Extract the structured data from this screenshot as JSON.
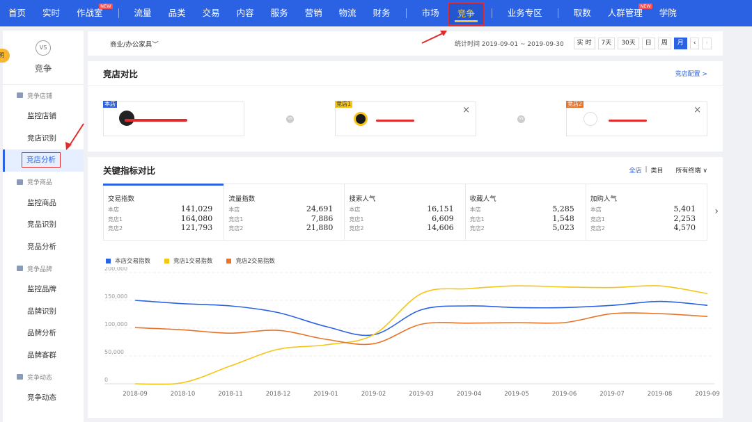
{
  "topnav": {
    "items": [
      {
        "label": "首页"
      },
      {
        "label": "实时"
      },
      {
        "label": "作战室",
        "badge": "NEW"
      },
      {
        "sep": true
      },
      {
        "label": "流量"
      },
      {
        "label": "品类"
      },
      {
        "label": "交易"
      },
      {
        "label": "内容"
      },
      {
        "label": "服务"
      },
      {
        "label": "营销"
      },
      {
        "label": "物流"
      },
      {
        "label": "财务"
      },
      {
        "sep": true
      },
      {
        "label": "市场"
      },
      {
        "label": "竞争",
        "active": true
      },
      {
        "sep": true
      },
      {
        "label": "业务专区"
      },
      {
        "sep": true
      },
      {
        "label": "取数"
      },
      {
        "label": "人群管理",
        "badge": "NEW"
      },
      {
        "label": "学院"
      }
    ]
  },
  "sidebar": {
    "peek": "明",
    "icon": "VS",
    "title": "竞争",
    "groups": [
      {
        "label": "竞争店铺",
        "items": [
          {
            "label": "监控店铺"
          },
          {
            "label": "竞店识别"
          },
          {
            "label": "竞店分析",
            "active": true
          }
        ]
      },
      {
        "label": "竞争商品",
        "items": [
          {
            "label": "监控商品"
          },
          {
            "label": "竞品识别"
          },
          {
            "label": "竞品分析"
          }
        ]
      },
      {
        "label": "竞争品牌",
        "items": [
          {
            "label": "监控品牌"
          },
          {
            "label": "品牌识别"
          },
          {
            "label": "品牌分析"
          },
          {
            "label": "品牌客群"
          }
        ]
      },
      {
        "label": "竞争动态",
        "items": [
          {
            "label": "竞争动态"
          }
        ]
      }
    ]
  },
  "filter": {
    "category": "商业/办公家具",
    "date_range": "统计时间 2019-09-01 ~ 2019-09-30",
    "periods": [
      {
        "label": "实 时"
      },
      {
        "label": "7天"
      },
      {
        "label": "30天"
      },
      {
        "label": "日"
      },
      {
        "label": "周"
      },
      {
        "label": "月",
        "active": true
      }
    ]
  },
  "compare": {
    "title": "竞店对比",
    "config_link": "竞店配置 >",
    "stores": [
      {
        "tag": "本店",
        "tag_color": "#2b62e3",
        "name": ""
      },
      {
        "tag": "竞店1",
        "tag_color": "#f5c518",
        "name": ""
      },
      {
        "tag": "竞店2",
        "tag_color": "#e8742c",
        "name": ""
      }
    ],
    "close": "×",
    "vs": "VS"
  },
  "metrics": {
    "title": "关键指标对比",
    "toggle_all": "全店",
    "toggle_sep": "|",
    "toggle_cat": "类目",
    "terminal": "所有终端 ∨",
    "cards": [
      {
        "title": "交易指数",
        "rows": [
          {
            "label": "本店",
            "value": "141,029"
          },
          {
            "label": "竞店1",
            "value": "164,080"
          },
          {
            "label": "竞店2",
            "value": "121,793"
          }
        ],
        "active": true
      },
      {
        "title": "流量指数",
        "rows": [
          {
            "label": "本店",
            "value": "24,691"
          },
          {
            "label": "竞店1",
            "value": "7,886"
          },
          {
            "label": "竞店2",
            "value": "21,880"
          }
        ]
      },
      {
        "title": "搜索人气",
        "rows": [
          {
            "label": "本店",
            "value": "16,151"
          },
          {
            "label": "竞店1",
            "value": "6,609"
          },
          {
            "label": "竞店2",
            "value": "14,606"
          }
        ]
      },
      {
        "title": "收藏人气",
        "rows": [
          {
            "label": "本店",
            "value": "5,285"
          },
          {
            "label": "竞店1",
            "value": "1,548"
          },
          {
            "label": "竞店2",
            "value": "5,023"
          }
        ]
      },
      {
        "title": "加购人气",
        "rows": [
          {
            "label": "本店",
            "value": "5,401"
          },
          {
            "label": "竞店1",
            "value": "2,253"
          },
          {
            "label": "竞店2",
            "value": "4,570"
          }
        ]
      }
    ],
    "next": "›"
  },
  "chart_data": {
    "type": "line",
    "categories": [
      "2018-09",
      "2018-10",
      "2018-11",
      "2018-12",
      "2019-01",
      "2019-02",
      "2019-03",
      "2019-04",
      "2019-05",
      "2019-06",
      "2019-07",
      "2019-08",
      "2019-09"
    ],
    "series": [
      {
        "name": "本店交易指数",
        "color": "#2b62e3",
        "values": [
          150000,
          144000,
          140000,
          128000,
          103000,
          88000,
          133000,
          140000,
          137000,
          137000,
          141000,
          148000,
          141000
        ]
      },
      {
        "name": "竞店1交易指数",
        "color": "#f5c518",
        "values": [
          0,
          2000,
          32000,
          62000,
          70000,
          88000,
          162000,
          171000,
          176000,
          174000,
          173000,
          176000,
          162000
        ]
      },
      {
        "name": "竞店2交易指数",
        "color": "#e8742c",
        "values": [
          101000,
          97000,
          91000,
          96000,
          80000,
          72000,
          107000,
          109000,
          110000,
          110000,
          126000,
          126000,
          121000
        ]
      }
    ],
    "yticks": [
      "200,000",
      "150,000",
      "100,000",
      "50,000",
      "0"
    ],
    "ylim": [
      0,
      200000
    ],
    "grid": true,
    "legend": "top-left"
  }
}
